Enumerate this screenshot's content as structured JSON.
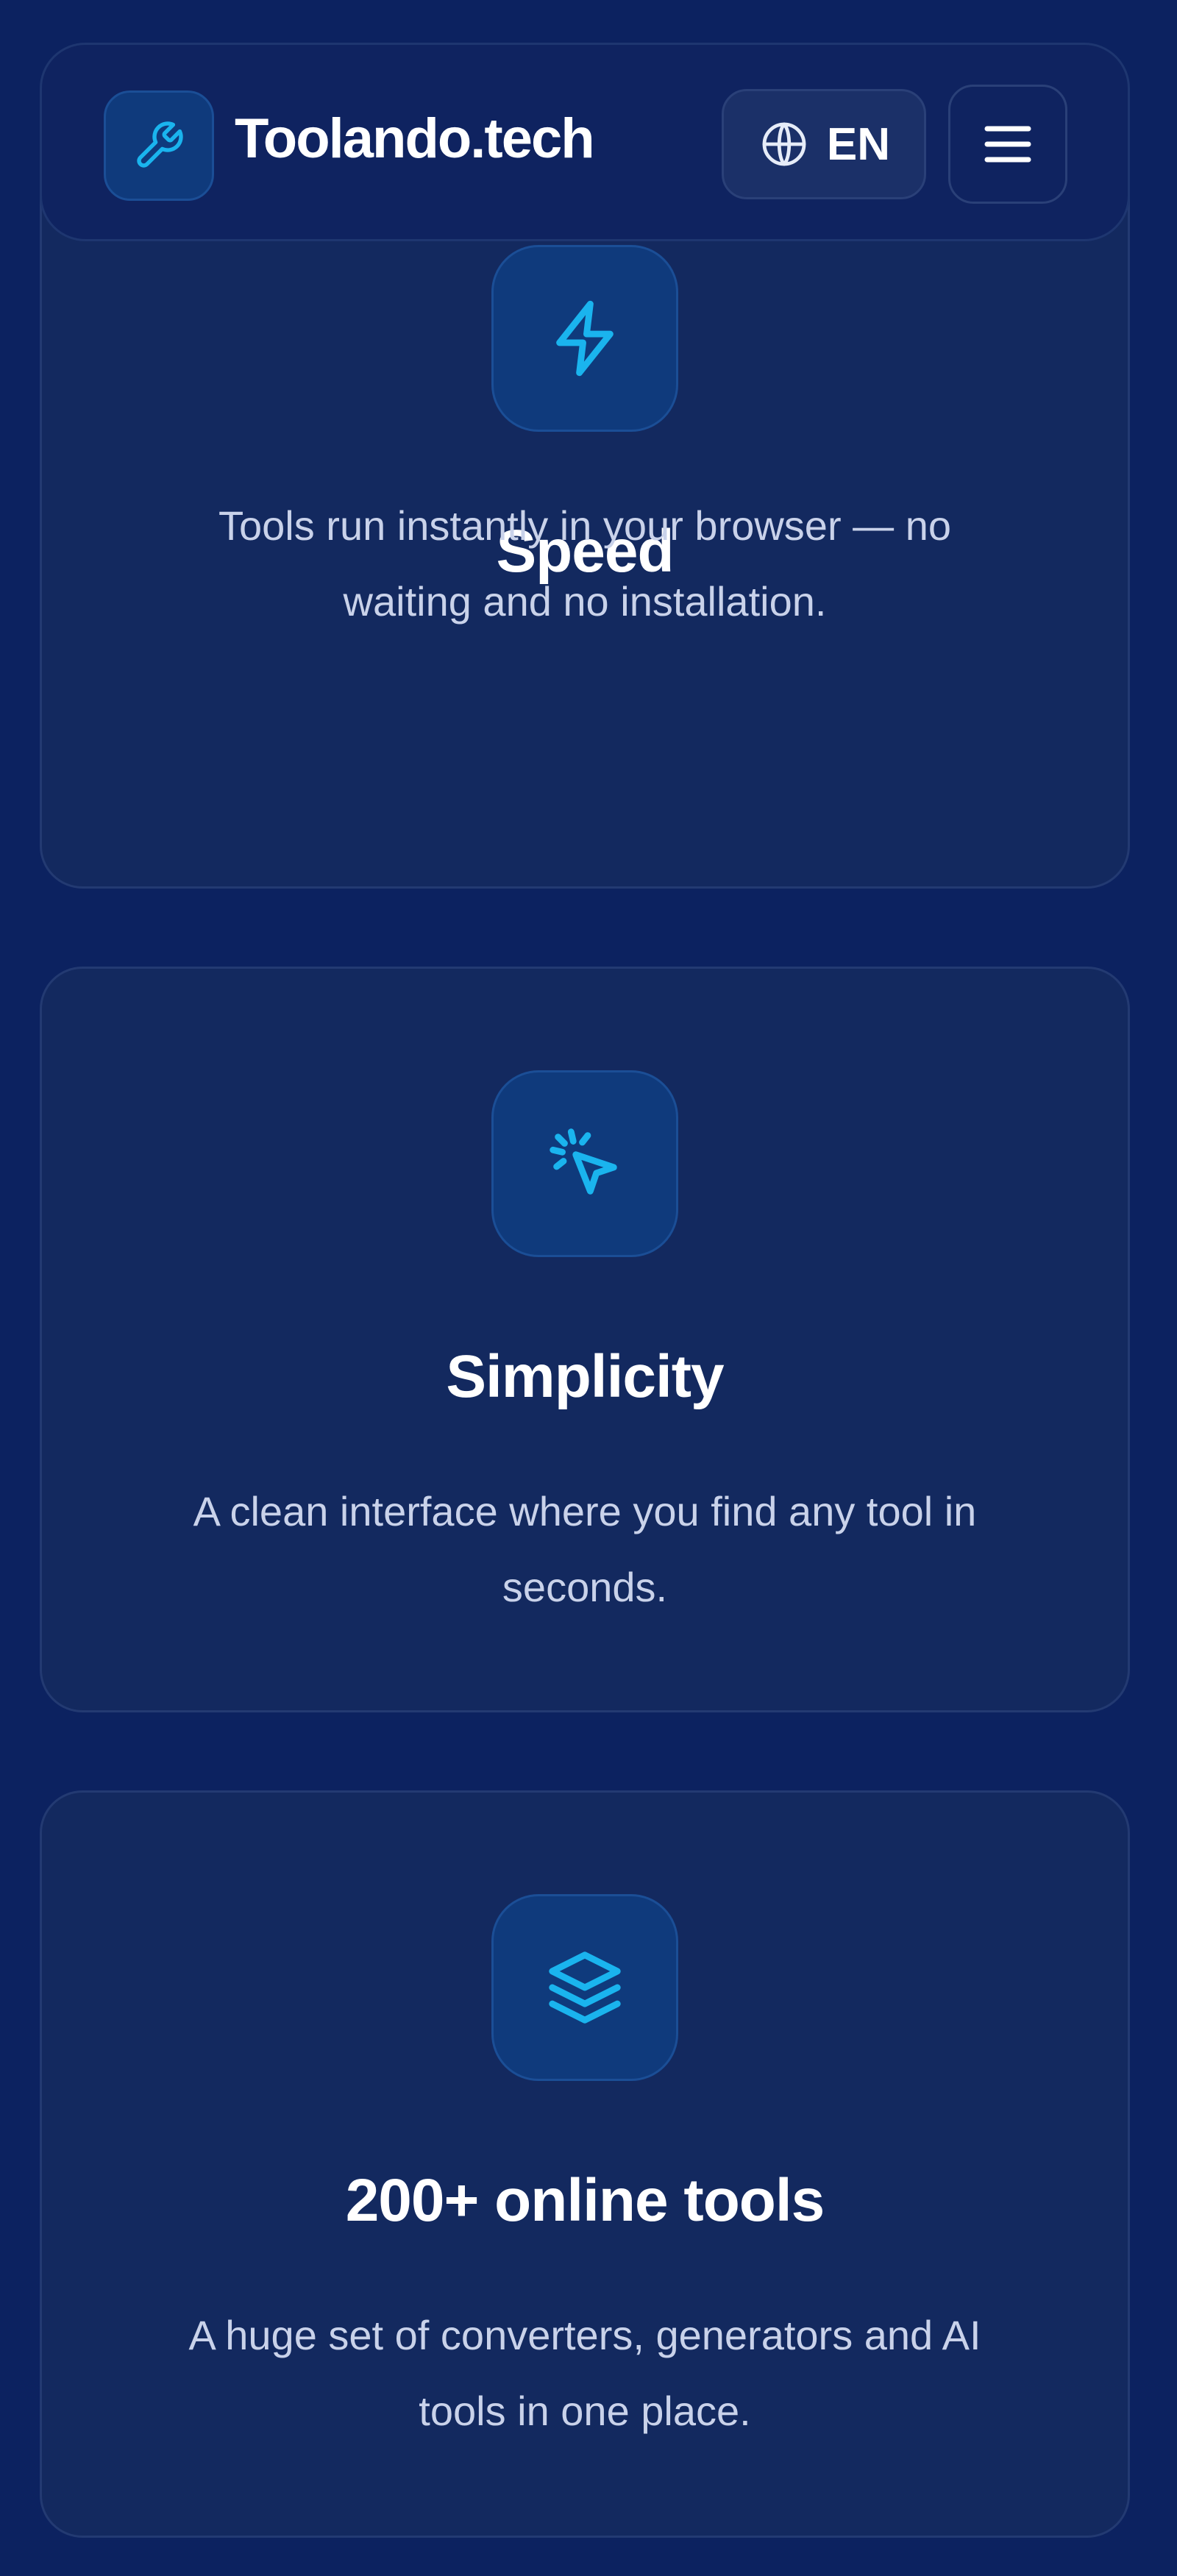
{
  "header": {
    "site_name": "Toolando.tech",
    "logo_icon": "wrench-icon",
    "language_icon": "globe-icon",
    "language_label": "EN",
    "menu_icon": "hamburger-menu-icon"
  },
  "features": [
    {
      "icon": "lightning-bolt-icon",
      "title": "Speed",
      "description": "Tools run instantly in your browser — no waiting and no installation."
    },
    {
      "icon": "cursor-click-icon",
      "title": "Simplicity",
      "description": "A clean interface where you find any tool in seconds."
    },
    {
      "icon": "layers-stack-icon",
      "title": "200+ online tools",
      "description": "A huge set of converters, generators and AI tools in one place."
    }
  ],
  "colors": {
    "background": "#0c2260",
    "card": "#13295f",
    "accent": "#1ab4ee",
    "text": "#ffffff",
    "muted_text": "#c9d2ea"
  }
}
